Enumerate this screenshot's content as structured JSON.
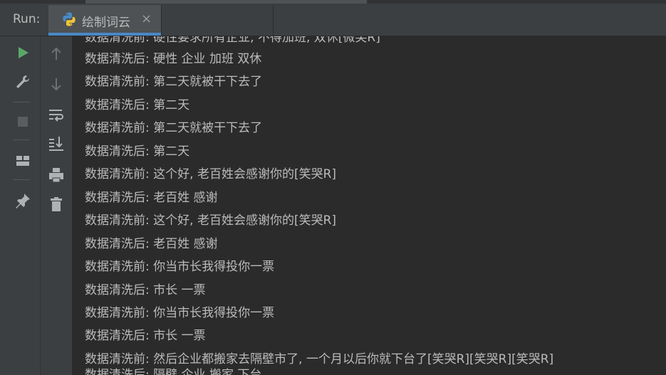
{
  "toolwindow": {
    "run_label": "Run:",
    "tab_title": "绘制词云",
    "tab_close": "×"
  },
  "icons": {
    "left_toolbar": [
      "run-icon",
      "wrench-icon",
      "stop-icon",
      "layout-icon",
      "pin-icon"
    ],
    "right_toolbar": [
      "up-arrow-icon",
      "down-arrow-icon",
      "soft-wrap-icon",
      "scroll-to-end-icon",
      "print-icon",
      "trash-icon"
    ]
  },
  "console": {
    "top_partial": "数据清洗前: 硬性要求所有企业, 不得加班, 双休[微笑R]",
    "lines": [
      "数据清洗后: 硬性 企业 加班 双休",
      "数据清洗前: 第二天就被干下去了",
      "数据清洗后: 第二天",
      "数据清洗前: 第二天就被干下去了",
      "数据清洗后: 第二天",
      "数据清洗前: 这个好, 老百姓会感谢你的[笑哭R]",
      "数据清洗后: 老百姓 感谢",
      "数据清洗前: 这个好, 老百姓会感谢你的[笑哭R]",
      "数据清洗后: 老百姓 感谢",
      "数据清洗前: 你当市长我得投你一票",
      "数据清洗后: 市长 一票",
      "数据清洗前: 你当市长我得投你一票",
      "数据清洗后: 市长 一票",
      "数据清洗前: 然后企业都搬家去隔壁市了, 一个月以后你就下台了[笑哭R][笑哭R][笑哭R]"
    ],
    "bottom_partial": "数据清洗后: 隔壁 企业 搬家 下台"
  },
  "colors": {
    "background": "#2b2b2b",
    "panel": "#3c3f41",
    "text": "#bbbbbb",
    "accent": "#4a88c7",
    "run_green": "#59a869"
  }
}
